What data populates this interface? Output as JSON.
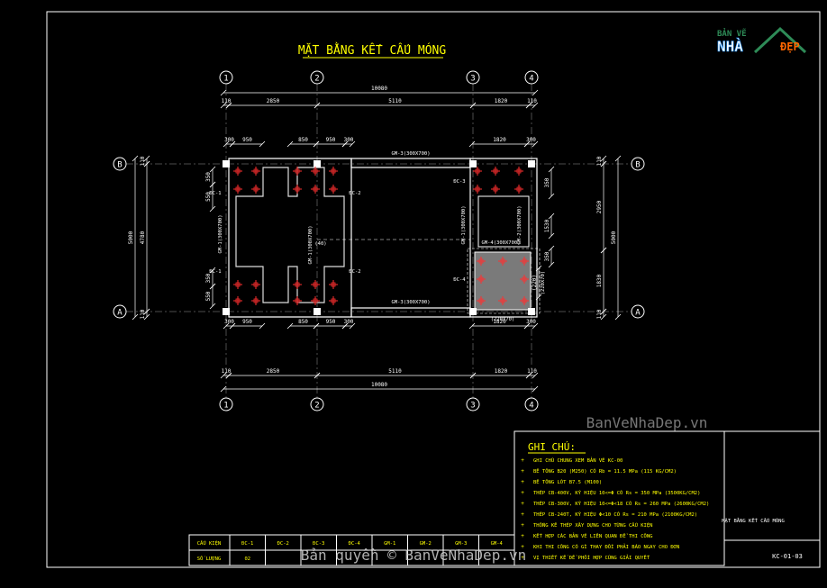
{
  "drawing": {
    "title": "MẶT BẰNG KẾT CẤU MÓNG",
    "axes_x": [
      "1",
      "2",
      "3",
      "4"
    ],
    "axes_y": [
      "A",
      "B"
    ],
    "dims_top": {
      "total": "10080",
      "spans": [
        "2850",
        "5110",
        "1820"
      ],
      "edges": [
        "110",
        "110"
      ]
    },
    "dims_bottom": {
      "total": "10080",
      "spans": [
        "2850",
        "5110",
        "1820"
      ],
      "edges": [
        "110",
        "110"
      ]
    },
    "dims_left": {
      "total": "5000",
      "inner": "4780",
      "edges": [
        "110",
        "110"
      ]
    },
    "dims_right": {
      "total": "5000",
      "parts": [
        "2950",
        "1830"
      ],
      "edges": [
        "110",
        "110"
      ]
    },
    "local_dims_top": [
      "300",
      "950",
      "850",
      "950",
      "300",
      "1820",
      "300"
    ],
    "local_dims_bottom": [
      "300",
      "950",
      "850",
      "950",
      "300",
      "1820",
      "300"
    ],
    "side_dims_left": [
      "350",
      "550",
      "350",
      "550"
    ],
    "side_dims_right": [
      "350",
      "350",
      "(220)",
      "1530"
    ],
    "beam_labels": {
      "gm3_top": "GM-3(300X700)",
      "gm3_bot": "GM-3(300X700)",
      "gm1_left": "GM-1(300X700)",
      "gm1_mid": "GM-1(300X700)",
      "gm1_right": "GM-1(300X700)",
      "gm4": "GM-4(300X700)",
      "gm2": "GM-2(300X700)",
      "gm2_bottom": "(220X70)",
      "gm2_side": "(220X70)",
      "mid_note": "(40)"
    },
    "foundation_labels": {
      "dc1_top": "ĐC-1",
      "dc2_top": "ĐC-2",
      "dc1_bot": "ĐC-1",
      "dc2_bot": "ĐC-2",
      "dc3": "ĐC-3",
      "dc4": "ĐC-4"
    }
  },
  "notes": {
    "heading": "GHI CHÚ:",
    "items": [
      "GHI CHÚ CHUNG XEM BẢN VẼ KC-00",
      "BÊ TÔNG B20 (M250) CÓ Rb = 11.5 MPa (115 KG/CM2)",
      "BÊ TÔNG LÓT B7.5 (M100)",
      "THÉP CB-400V, KÝ HIỆU 10<=Φ CÓ Rs = 350 MPa (3500KG/CM2)",
      "THÉP CB-300V, KÝ HIỆU 10<=Φ<18 CÓ Rs = 260 MPa (2600KG/CM2)",
      "THÉP CB-240T, KÝ HIỆU Φ<10 CÓ Rs = 210 MPa (2100KG/CM2)",
      "THỐNG KÊ THÉP XÂY DỰNG CHO TỪNG CẤU KIỆN",
      "KẾT HỢP CÁC BẢN VẼ LIÊN QUAN ĐỂ THI CÔNG",
      "KHI THI CÔNG CÓ GÌ THAY ĐỔI PHẢI BÁO NGAY CHO ĐƠN",
      "VỊ THIẾT KẾ ĐỂ PHỐI HỢP CÙNG GIẢI QUYẾT"
    ]
  },
  "table": {
    "row1_label": "CẤU KIỆN",
    "row2_label": "SỐ LƯỢNG",
    "columns": [
      "ĐC-1",
      "ĐC-2",
      "ĐC-3",
      "ĐC-4",
      "GM-1",
      "GM-2",
      "GM-3",
      "GM-4"
    ],
    "counts": [
      "02",
      "",
      "",
      "",
      "",
      "",
      "",
      ""
    ]
  },
  "titleblock": {
    "sheet_name": "MẶT BẰNG KẾT CẤU MÓNG",
    "sheet_code": "KC-01-03"
  },
  "brand": {
    "logo_line1": "BẢN VẼ",
    "logo_nha": "NHÀ",
    "logo_dep": "ĐẸP",
    "watermark_site": "BanVeNhaDep.vn",
    "copyright": "Bản quyền © BanVeNhaDep.vn"
  },
  "colors": {
    "background": "#000000",
    "grid_bubble": "#ffffff",
    "beam": "#ffffff",
    "footing": "#ffffff",
    "rebar": "#ff0000",
    "text_main": "#ffff00",
    "dims": "#ffffff",
    "hatch": "#808080"
  }
}
